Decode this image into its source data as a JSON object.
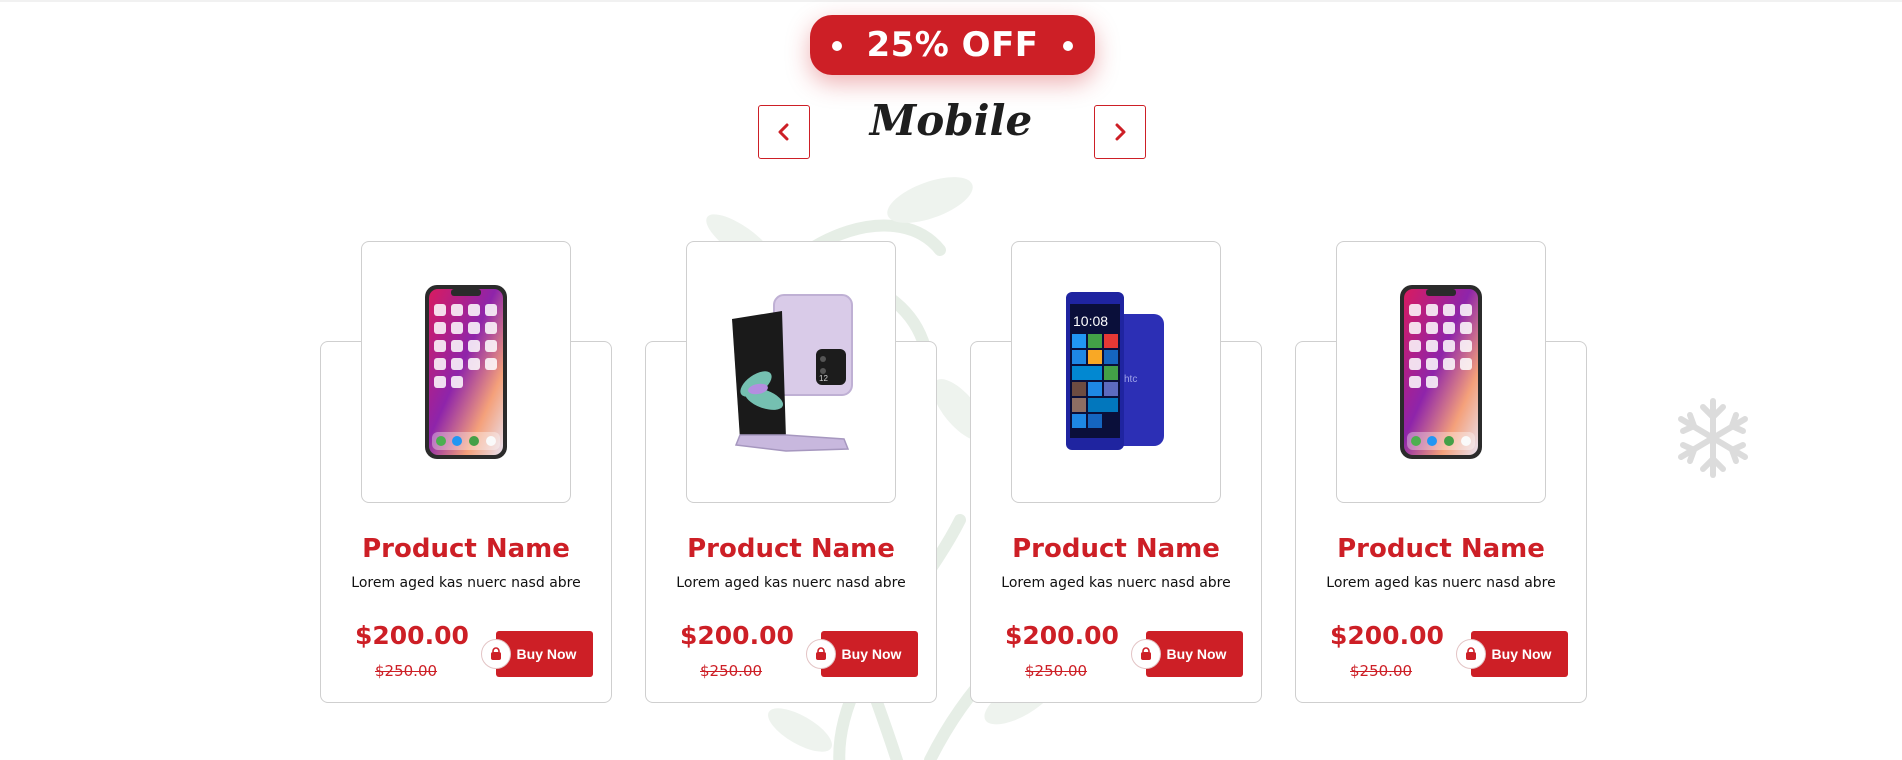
{
  "badge": {
    "text": "25% OFF"
  },
  "category": {
    "title": "Mobile",
    "prev_icon": "chevron-left-icon",
    "next_icon": "chevron-right-icon"
  },
  "colors": {
    "accent": "#cd1f26",
    "border": "#cfcfcf",
    "title": "#1e1e1e"
  },
  "products": [
    {
      "image": "iphone-x-icon",
      "name": "Product Name",
      "description": "Lorem aged kas nuerc nasd abre",
      "price": "$200.00",
      "old_price": "$250.00",
      "button": "Buy Now"
    },
    {
      "image": "galaxy-flip-icon",
      "name": "Product Name",
      "description": "Lorem aged kas nuerc nasd abre",
      "price": "$200.00",
      "old_price": "$250.00",
      "button": "Buy Now"
    },
    {
      "image": "htc-windows-phone-icon",
      "name": "Product Name",
      "description": "Lorem aged kas nuerc nasd abre",
      "price": "$200.00",
      "old_price": "$250.00",
      "button": "Buy Now"
    },
    {
      "image": "iphone-x-icon",
      "name": "Product Name",
      "description": "Lorem aged kas nuerc nasd abre",
      "price": "$200.00",
      "old_price": "$250.00",
      "button": "Buy Now"
    }
  ],
  "decorations": {
    "background": "floral-swirl-icon",
    "corner": "snowflake-icon"
  }
}
